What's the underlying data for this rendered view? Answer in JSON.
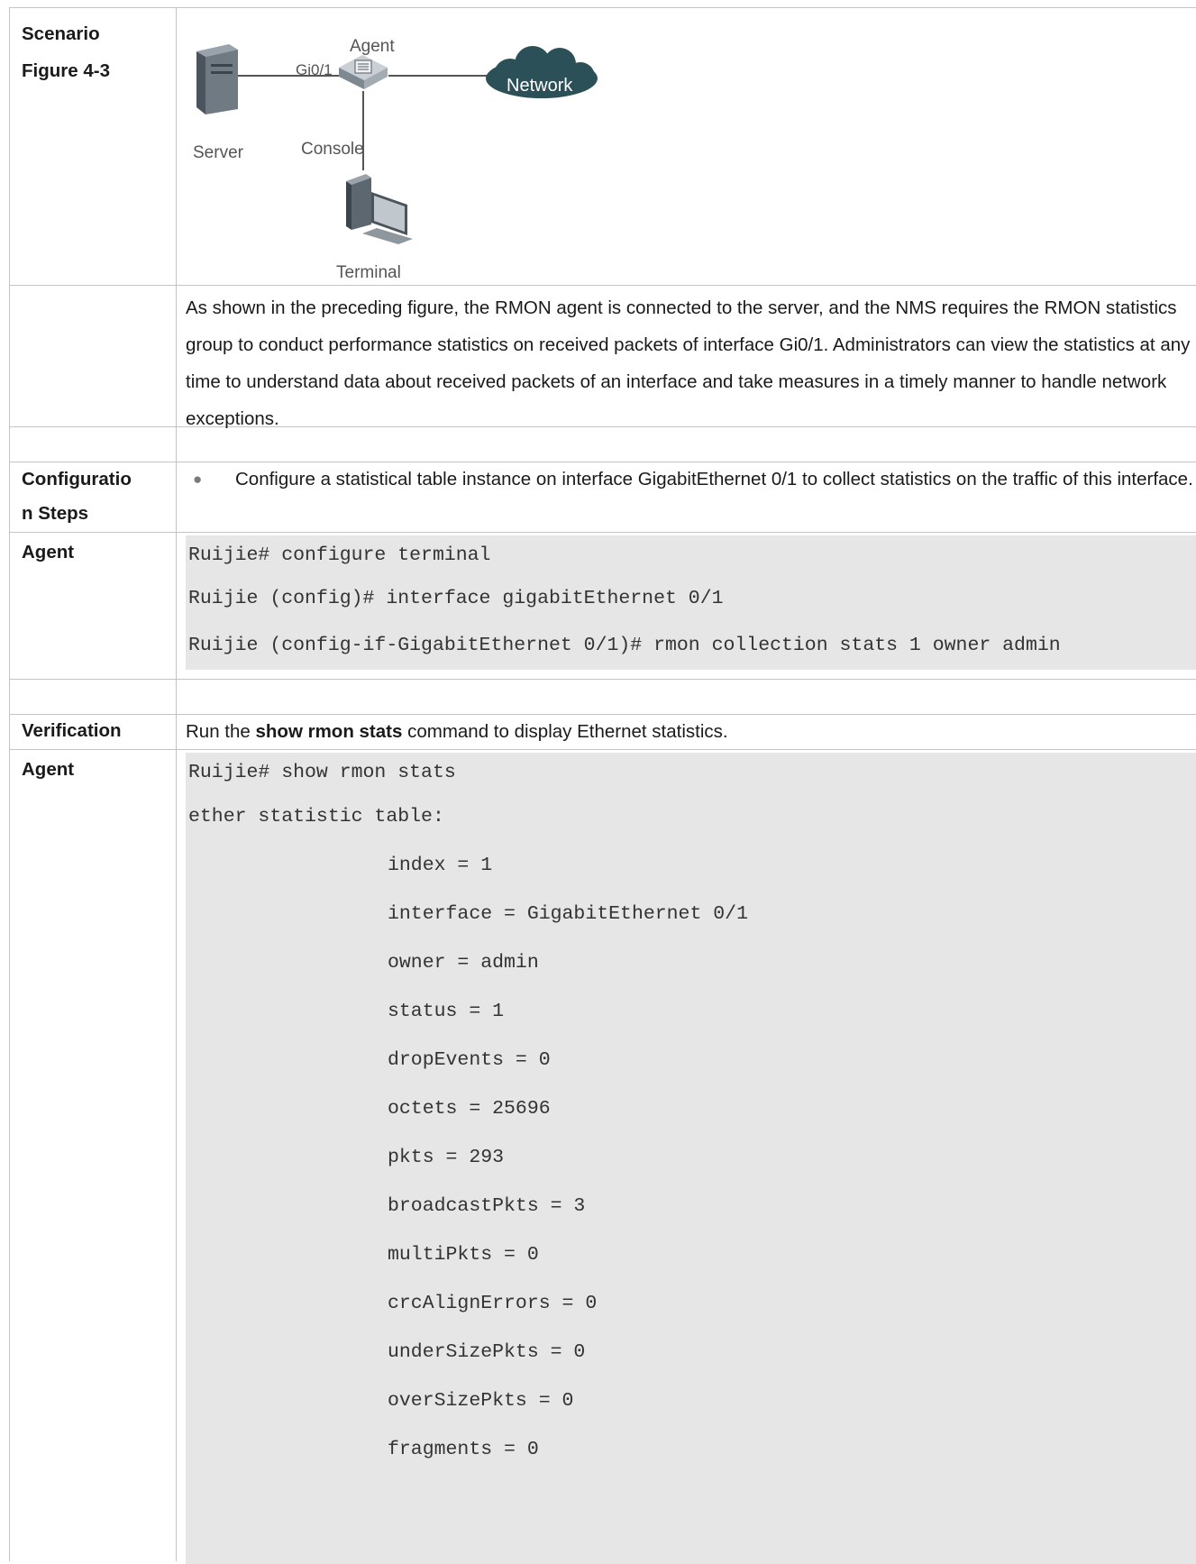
{
  "scenario": {
    "label_line1": "Scenario",
    "label_line2": "Figure 4-3",
    "figure": {
      "agent": "Agent",
      "port": "Gi0/1",
      "network": "Network",
      "server": "Server",
      "console": "Console",
      "terminal": "Terminal"
    },
    "description": "As shown in the preceding figure, the RMON agent is connected to the server, and the NMS requires the RMON statistics group to conduct performance statistics on received packets of interface Gi0/1. Administrators can view the statistics at any time to understand data about received packets of an interface and take measures in a timely manner to handle network exceptions."
  },
  "config": {
    "label": "Configuratio n Steps",
    "label_line1": "Configuratio",
    "label_line2": "n Steps",
    "bullet": "Configure a statistical table instance on interface GigabitEthernet 0/1 to collect statistics on the traffic of this interface."
  },
  "agent_config": {
    "label": "Agent",
    "lines": [
      "Ruijie# configure terminal",
      "Ruijie (config)# interface gigabitEthernet 0/1",
      "Ruijie (config-if-GigabitEthernet 0/1)# rmon collection stats 1 owner admin"
    ]
  },
  "verification": {
    "label": "Verification",
    "text_pre": "Run the ",
    "text_cmd": "show rmon stats",
    "text_post": " command to display Ethernet statistics."
  },
  "agent_output": {
    "label": "Agent",
    "header_lines": [
      "Ruijie# show rmon stats",
      "ether statistic table:"
    ],
    "stat_lines": [
      "index = 1",
      "interface = GigabitEthernet 0/1",
      "owner = admin",
      "status = 1",
      "dropEvents = 0",
      "octets = 25696",
      "pkts = 293",
      "broadcastPkts = 3",
      "multiPkts = 0",
      "crcAlignErrors = 0",
      "underSizePkts = 0",
      "overSizePkts = 0",
      "fragments = 0"
    ]
  }
}
